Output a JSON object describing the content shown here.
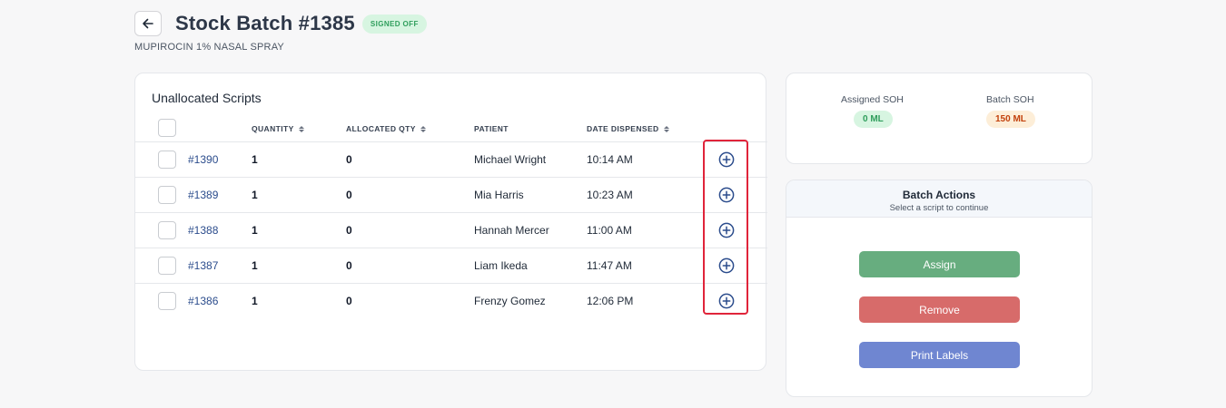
{
  "header": {
    "title": "Stock Batch #1385",
    "status": "SIGNED OFF",
    "product": "MUPIROCIN 1% NASAL SPRAY"
  },
  "scripts": {
    "title": "Unallocated Scripts",
    "columns": {
      "quantity": "QUANTITY",
      "allocated": "ALLOCATED QTY",
      "patient": "PATIENT",
      "date": "DATE DISPENSED"
    },
    "rows": [
      {
        "id": "#1390",
        "quantity": "1",
        "allocated": "0",
        "patient": "Michael Wright",
        "date": "10:14 AM"
      },
      {
        "id": "#1389",
        "quantity": "1",
        "allocated": "0",
        "patient": "Mia Harris",
        "date": "10:23 AM"
      },
      {
        "id": "#1388",
        "quantity": "1",
        "allocated": "0",
        "patient": "Hannah Mercer",
        "date": "11:00 AM"
      },
      {
        "id": "#1387",
        "quantity": "1",
        "allocated": "0",
        "patient": "Liam Ikeda",
        "date": "11:47 AM"
      },
      {
        "id": "#1386",
        "quantity": "1",
        "allocated": "0",
        "patient": "Frenzy Gomez",
        "date": "12:06 PM"
      }
    ]
  },
  "soh": {
    "assigned_label": "Assigned SOH",
    "assigned_value": "0 ML",
    "batch_label": "Batch SOH",
    "batch_value": "150 ML"
  },
  "actions": {
    "title": "Batch Actions",
    "subtitle": "Select a script to continue",
    "assign": "Assign",
    "remove": "Remove",
    "print": "Print Labels"
  },
  "icons": {
    "back": "arrow-left-icon",
    "add": "plus-circle-icon",
    "sort": "sort-icon"
  },
  "colors": {
    "signed_off_bg": "#d7f5e1",
    "signed_off_text": "#2f9e5c",
    "assign": "#67ad7f",
    "remove": "#d76b6a",
    "print": "#6f86d1",
    "highlight": "#e0243a"
  }
}
